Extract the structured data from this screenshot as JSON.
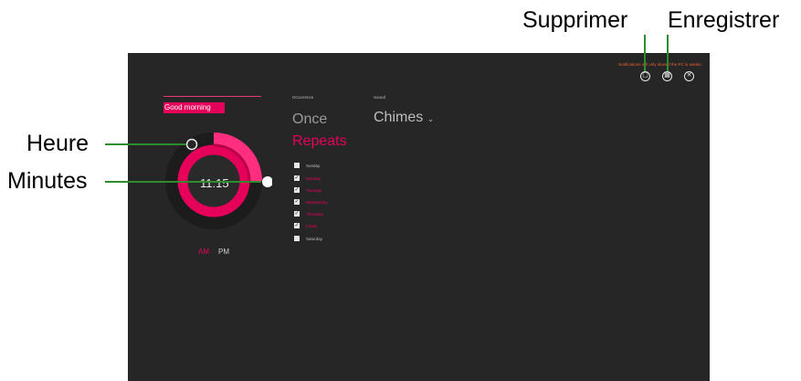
{
  "callouts": {
    "hour": "Heure",
    "minutes": "Minutes",
    "delete": "Supprimer",
    "save": "Enregistrer"
  },
  "alarm": {
    "notice": "Notifications will only show if the PC is awake.",
    "name": "Good morning",
    "time": "11:15",
    "am": "AM",
    "pm": "PM"
  },
  "occurrence": {
    "label": "Occurrence",
    "once": "Once",
    "repeats": "Repeats"
  },
  "sound": {
    "label": "Sound",
    "value": "Chimes"
  },
  "days": [
    {
      "label": "Sunday",
      "checked": false
    },
    {
      "label": "Monday",
      "checked": true
    },
    {
      "label": "Tuesday",
      "checked": true
    },
    {
      "label": "Wednesday",
      "checked": true
    },
    {
      "label": "Thursday",
      "checked": true
    },
    {
      "label": "Friday",
      "checked": true
    },
    {
      "label": "Saturday",
      "checked": false
    }
  ],
  "colors": {
    "accent": "#e5005a",
    "background": "#262626",
    "callout_line": "#2e8b2e",
    "notice": "#e8602c"
  },
  "icons": {
    "delete": "trash-icon",
    "save": "save-icon",
    "close": "close-icon",
    "sound_dropdown": "chevron-down-icon"
  }
}
